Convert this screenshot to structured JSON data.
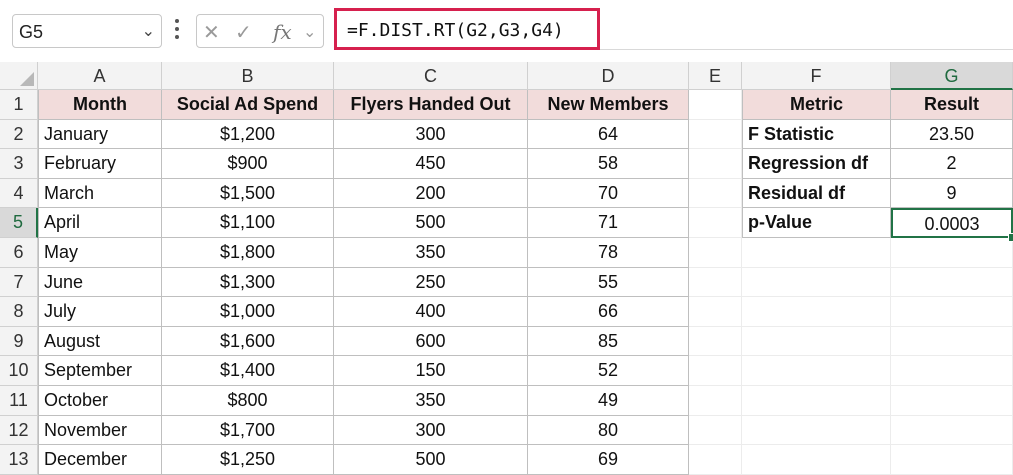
{
  "formula_bar": {
    "name_box": "G5",
    "formula": "=F.DIST.RT(G2,G3,G4)",
    "fx_label": "fx",
    "icons": {
      "name_box_dropdown": "chevron-down-icon",
      "more": "kebab-icon",
      "cancel": "cancel-x-icon",
      "enter": "checkmark-icon",
      "insert_function": "fx-icon",
      "expand": "chevron-down-icon"
    },
    "highlight_color": "#d6204e"
  },
  "sheet": {
    "columns": [
      "A",
      "B",
      "C",
      "D",
      "E",
      "F",
      "G"
    ],
    "selected_column": "G",
    "rows": [
      "1",
      "2",
      "3",
      "4",
      "5",
      "6",
      "7",
      "8",
      "9",
      "10",
      "11",
      "12",
      "13"
    ],
    "selected_row": "5",
    "header_fill": "#f2dcdb",
    "selection_color": "#217346",
    "main_table": {
      "headers": [
        "Month",
        "Social Ad Spend",
        "Flyers Handed Out",
        "New Members"
      ],
      "rows": [
        [
          "January",
          "$1,200",
          "300",
          "64"
        ],
        [
          "February",
          "$900",
          "450",
          "58"
        ],
        [
          "March",
          "$1,500",
          "200",
          "70"
        ],
        [
          "April",
          "$1,100",
          "500",
          "71"
        ],
        [
          "May",
          "$1,800",
          "350",
          "78"
        ],
        [
          "June",
          "$1,300",
          "250",
          "55"
        ],
        [
          "July",
          "$1,000",
          "400",
          "66"
        ],
        [
          "August",
          "$1,600",
          "600",
          "85"
        ],
        [
          "September",
          "$1,400",
          "150",
          "52"
        ],
        [
          "October",
          "$800",
          "350",
          "49"
        ],
        [
          "November",
          "$1,700",
          "300",
          "80"
        ],
        [
          "December",
          "$1,250",
          "500",
          "69"
        ]
      ]
    },
    "result_table": {
      "headers": [
        "Metric",
        "Result"
      ],
      "rows": [
        [
          "F Statistic",
          "23.50"
        ],
        [
          "Regression df",
          "2"
        ],
        [
          "Residual df",
          "9"
        ],
        [
          "p-Value",
          "0.0003"
        ]
      ]
    },
    "active_cell": "G5"
  }
}
